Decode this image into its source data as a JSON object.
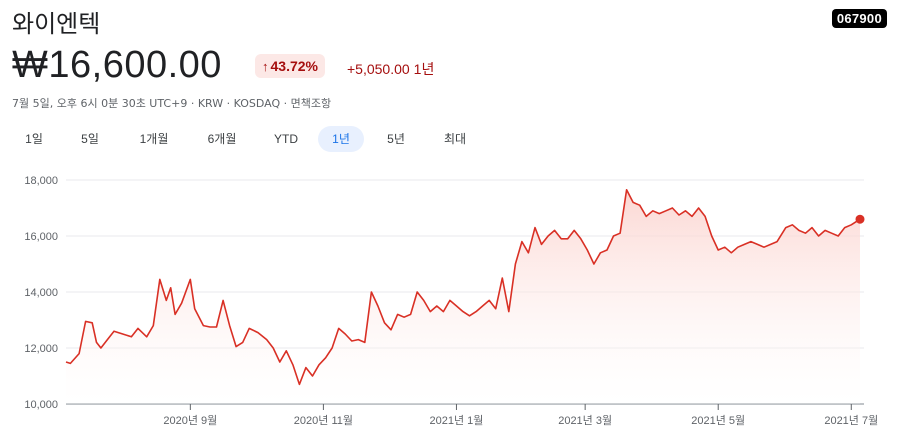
{
  "header": {
    "company_name": "와이엔텍",
    "ticker": "067900",
    "price": "₩16,600.00",
    "change_pct": "43.72%",
    "change_abs": "+5,050.00",
    "change_period": "1년",
    "meta": "7월 5일, 오후 6시 0분 30초 UTC+9 · KRW · KOSDAQ · 면책조항"
  },
  "tabs": [
    {
      "label": "1일",
      "active": false
    },
    {
      "label": "5일",
      "active": false
    },
    {
      "label": "1개월",
      "active": false
    },
    {
      "label": "6개월",
      "active": false
    },
    {
      "label": "YTD",
      "active": false
    },
    {
      "label": "1년",
      "active": true
    },
    {
      "label": "5년",
      "active": false
    },
    {
      "label": "최대",
      "active": false
    }
  ],
  "colors": {
    "line": "#d93025",
    "fill_top": "#fbd0cb",
    "grid": "#e8eaed",
    "up": "#a50e0e",
    "active_tab": "#1a73e8"
  },
  "chart_data": {
    "type": "area",
    "title": "",
    "xlabel": "",
    "ylabel": "",
    "ylim": [
      10000,
      18000
    ],
    "yticks": [
      {
        "value": 10000,
        "label": "10,000"
      },
      {
        "value": 12000,
        "label": "12,000"
      },
      {
        "value": 14000,
        "label": "14,000"
      },
      {
        "value": 16000,
        "label": "16,000"
      },
      {
        "value": 18000,
        "label": "18,000"
      }
    ],
    "xlim": [
      "2020-07-06",
      "2021-07-05"
    ],
    "xticks": [
      {
        "date": "2020-09-01",
        "label": "2020년 9월"
      },
      {
        "date": "2020-11-01",
        "label": "2020년 11월"
      },
      {
        "date": "2021-01-01",
        "label": "2021년 1월"
      },
      {
        "date": "2021-03-01",
        "label": "2021년 3월"
      },
      {
        "date": "2021-05-01",
        "label": "2021년 5월"
      },
      {
        "date": "2021-07-01",
        "label": "2021년 7월"
      }
    ],
    "grid": true,
    "series": [
      {
        "x": [
          "2020-07-06",
          "2020-07-08",
          "2020-07-12",
          "2020-07-15",
          "2020-07-18",
          "2020-07-20",
          "2020-07-22",
          "2020-07-25",
          "2020-07-28",
          "2020-08-01",
          "2020-08-05",
          "2020-08-08",
          "2020-08-12",
          "2020-08-15",
          "2020-08-18",
          "2020-08-21",
          "2020-08-23",
          "2020-08-25",
          "2020-08-28",
          "2020-09-01",
          "2020-09-03",
          "2020-09-07",
          "2020-09-10",
          "2020-09-13",
          "2020-09-16",
          "2020-09-19",
          "2020-09-22",
          "2020-09-25",
          "2020-09-28",
          "2020-10-02",
          "2020-10-06",
          "2020-10-09",
          "2020-10-12",
          "2020-10-15",
          "2020-10-18",
          "2020-10-21",
          "2020-10-24",
          "2020-10-27",
          "2020-10-30",
          "2020-11-02",
          "2020-11-05",
          "2020-11-08",
          "2020-11-11",
          "2020-11-14",
          "2020-11-17",
          "2020-11-20",
          "2020-11-23",
          "2020-11-26",
          "2020-11-29",
          "2020-12-02",
          "2020-12-05",
          "2020-12-08",
          "2020-12-11",
          "2020-12-14",
          "2020-12-17",
          "2020-12-20",
          "2020-12-23",
          "2020-12-26",
          "2020-12-29",
          "2021-01-01",
          "2021-01-04",
          "2021-01-07",
          "2021-01-10",
          "2021-01-13",
          "2021-01-16",
          "2021-01-19",
          "2021-01-22",
          "2021-01-25",
          "2021-01-28",
          "2021-01-31",
          "2021-02-03",
          "2021-02-06",
          "2021-02-09",
          "2021-02-12",
          "2021-02-15",
          "2021-02-18",
          "2021-02-21",
          "2021-02-24",
          "2021-02-27",
          "2021-03-02",
          "2021-03-05",
          "2021-03-08",
          "2021-03-11",
          "2021-03-14",
          "2021-03-17",
          "2021-03-20",
          "2021-03-23",
          "2021-03-26",
          "2021-03-29",
          "2021-04-01",
          "2021-04-04",
          "2021-04-07",
          "2021-04-10",
          "2021-04-13",
          "2021-04-16",
          "2021-04-19",
          "2021-04-22",
          "2021-04-25",
          "2021-04-28",
          "2021-05-01",
          "2021-05-04",
          "2021-05-07",
          "2021-05-10",
          "2021-05-13",
          "2021-05-16",
          "2021-05-19",
          "2021-05-22",
          "2021-05-25",
          "2021-05-28",
          "2021-06-01",
          "2021-06-04",
          "2021-06-07",
          "2021-06-10",
          "2021-06-13",
          "2021-06-16",
          "2021-06-19",
          "2021-06-22",
          "2021-06-25",
          "2021-06-28",
          "2021-07-01",
          "2021-07-05"
        ],
        "values": [
          11500,
          11450,
          11800,
          12950,
          12900,
          12200,
          12000,
          12300,
          12600,
          12500,
          12400,
          12700,
          12400,
          12800,
          14450,
          13700,
          14150,
          13200,
          13600,
          14450,
          13400,
          12800,
          12750,
          12750,
          13700,
          12800,
          12050,
          12200,
          12700,
          12550,
          12300,
          12000,
          11500,
          11900,
          11400,
          10700,
          11300,
          11000,
          11400,
          11650,
          12000,
          12700,
          12500,
          12250,
          12300,
          12200,
          14000,
          13500,
          12900,
          12650,
          13200,
          13100,
          13200,
          14000,
          13700,
          13300,
          13500,
          13300,
          13700,
          13500,
          13300,
          13150,
          13300,
          13500,
          13700,
          13400,
          14500,
          13300,
          15000,
          15800,
          15400,
          16300,
          15700,
          16000,
          16200,
          15900,
          15900,
          16200,
          15900,
          15500,
          15000,
          15400,
          15500,
          16000,
          16100,
          17650,
          17200,
          17100,
          16700,
          16900,
          16800,
          16900,
          17000,
          16750,
          16900,
          16700,
          17000,
          16700,
          16000,
          15500,
          15600,
          15400,
          15600,
          15700,
          15800,
          15700,
          15600,
          15700,
          15800,
          16300,
          16400,
          16200,
          16100,
          16300,
          16000,
          16200,
          16100,
          16000,
          16300,
          16400,
          16600
        ]
      }
    ],
    "last_point": {
      "date": "2021-07-05",
      "value": 16600
    }
  }
}
